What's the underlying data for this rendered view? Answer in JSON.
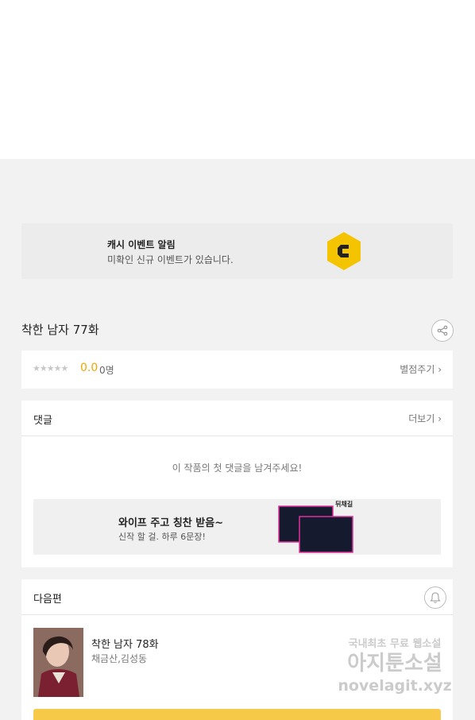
{
  "event_banner": {
    "title": "캐시 이벤트 알림",
    "subtitle": "미확인 신규 이벤트가 있습니다.",
    "logo_icon": "cash-c-logo-icon",
    "accent_color": "#f5c400"
  },
  "episode": {
    "title": "착한 남자 77화",
    "share_icon": "share-icon"
  },
  "rating": {
    "stars": "★★★★★",
    "score": "0.0",
    "count": "0명",
    "rate_link": "별점주기 ›"
  },
  "comments": {
    "title": "댓글",
    "more_link": "더보기 ›",
    "empty_message": "이 작품의 첫 댓글을 남겨주세요!",
    "ad": {
      "title": "와이프 주고 칭찬 받음~",
      "subtitle": "신작 할 걸. 하루 6문장!",
      "brand": "뒤채길"
    }
  },
  "next_episode": {
    "header": "다음편",
    "bell_icon": "bell-icon",
    "title": "착한 남자 78화",
    "authors": "채금산,김성동",
    "watermark_line1": "국내최초 무료 웹소설",
    "watermark_line2": "아지툰소설",
    "watermark_line3": "novelagit.xyz",
    "button_color": "#f7c948"
  }
}
